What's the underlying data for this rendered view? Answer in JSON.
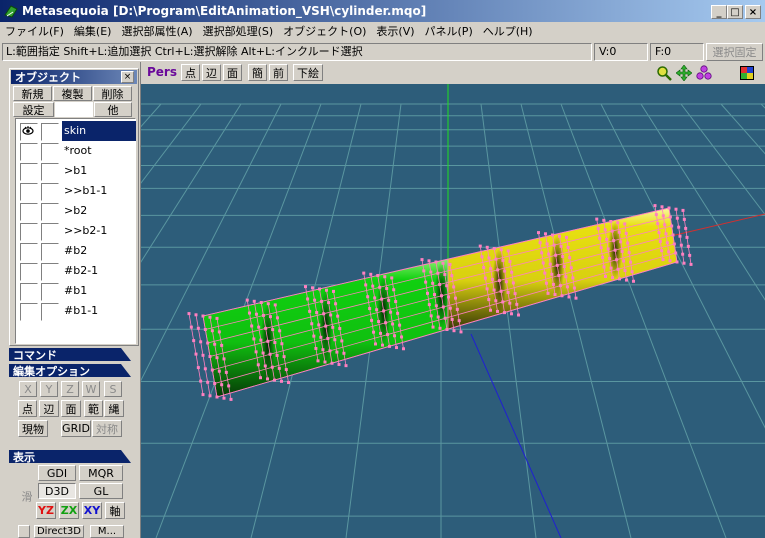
{
  "window": {
    "title": "Metasequoia [D:\\Program\\EditAnimation_VSH\\cylinder.mqo]",
    "controls": [
      "_",
      "□",
      "×"
    ]
  },
  "menu": [
    "ファイル(F)",
    "編集(E)",
    "選択部属性(A)",
    "選択部処理(S)",
    "オブジェクト(O)",
    "表示(V)",
    "パネル(P)",
    "ヘルプ(H)"
  ],
  "status": {
    "hint": "L:範囲指定  Shift+L:追加選択  Ctrl+L:選択解除  Alt+L:インクルード選択",
    "vertex": "V:0",
    "face": "F:0",
    "lock_button": "選択固定"
  },
  "object_panel": {
    "title": "オブジェクト",
    "close": "×",
    "buttons": [
      "新規",
      "複製",
      "削除",
      "設定",
      "他"
    ],
    "objects": [
      {
        "name": "skin",
        "visible": true,
        "selected": true
      },
      {
        "name": "*root",
        "visible": false,
        "selected": false
      },
      {
        "name": ">b1",
        "visible": false,
        "selected": false
      },
      {
        "name": ">>b1-1",
        "visible": false,
        "selected": false
      },
      {
        "name": ">b2",
        "visible": false,
        "selected": false
      },
      {
        "name": ">>b2-1",
        "visible": false,
        "selected": false
      },
      {
        "name": "#b2",
        "visible": false,
        "selected": false
      },
      {
        "name": "#b2-1",
        "visible": false,
        "selected": false
      },
      {
        "name": "#b1",
        "visible": false,
        "selected": false
      },
      {
        "name": "#b1-1",
        "visible": false,
        "selected": false
      }
    ]
  },
  "command_panel": {
    "title": "コマンド"
  },
  "edit_options": {
    "title": "編集オプション",
    "axes": [
      "X",
      "Y",
      "Z",
      "W",
      "S"
    ],
    "modes": [
      "点",
      "辺",
      "面",
      "範",
      "縄"
    ],
    "row3": [
      "現物",
      "GRID",
      "対称"
    ]
  },
  "display_panel": {
    "title": "表示",
    "side_label": "滑",
    "gdi": "GDI",
    "mqr": "MQR",
    "d3d": "D3D",
    "gl": "GL",
    "views": [
      "YZ",
      "ZX",
      "XY",
      "軸"
    ],
    "bottom": [
      "Direct3D",
      "M..."
    ]
  },
  "viewport": {
    "mode": "Pers",
    "toolbar": [
      "点",
      "辺",
      "面",
      "簡",
      "前",
      "下絵"
    ],
    "icons": [
      "zoom-icon",
      "move-view-icon",
      "rotate-view-icon",
      "layout-icon"
    ],
    "colors": {
      "background": "#2d5d7a",
      "grid": "#5a96a0",
      "green_part": "#10d010",
      "yellow_part": "#e8e010",
      "vertex": "#ff80c0",
      "axis_y": "#20e020",
      "axis_x": "#d03030",
      "axis_z": "#2020d0"
    }
  }
}
